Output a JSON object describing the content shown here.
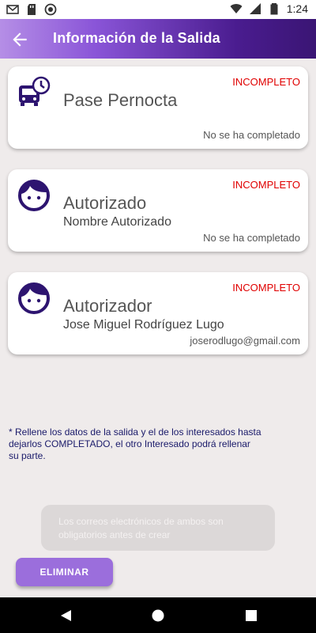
{
  "status_bar": {
    "time": "1:24",
    "icons": [
      "gmail-icon",
      "sd-card-icon",
      "record-icon",
      "wifi-icon",
      "signal-icon",
      "battery-icon"
    ]
  },
  "app_bar": {
    "title": "Información de la Salida",
    "back_icon": "arrow-left-icon"
  },
  "cards": [
    {
      "icon": "bus-clock-icon",
      "status": "INCOMPLETO",
      "title": "Pase Pernocta",
      "subtitle": "",
      "footer": "No se ha completado"
    },
    {
      "icon": "face-icon",
      "status": "INCOMPLETO",
      "title": "Autorizado",
      "subtitle": "Nombre Autorizado",
      "footer": "No se ha completado"
    },
    {
      "icon": "face-icon",
      "status": "INCOMPLETO",
      "title": "Autorizador",
      "subtitle": "Jose Miguel Rodríguez Lugo",
      "footer": "joserodlugo@gmail.com"
    }
  ],
  "note": "* Rellene los datos de la salida y el de los interesados hasta dejarlos COMPLETADO, el otro Interesado podrá rellenar su parte.",
  "toast": "Los correos electrónicos de ambos son obligatorios antes de crear",
  "delete_button": "ELIMINAR",
  "colors": {
    "primary": "#3a1574",
    "accent": "#9b6edc",
    "incomplete": "#e00000",
    "icon": "#2d1470"
  }
}
